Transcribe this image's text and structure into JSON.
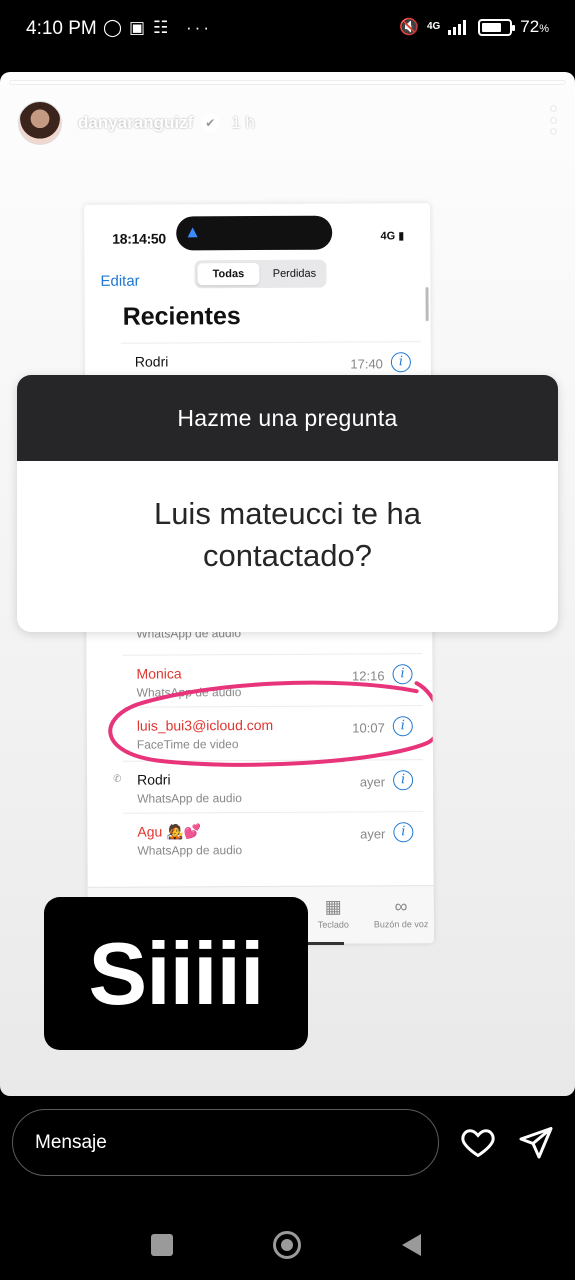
{
  "status_bar": {
    "time": "4:10 PM",
    "network": "4G",
    "battery_percent": "72",
    "battery_level": 0.72
  },
  "story": {
    "progress": 1.0,
    "username": "danyaranguizf",
    "time_ago": "1 h",
    "verified": true
  },
  "embedded_screenshot": {
    "time": "18:14:50",
    "signal": "4G",
    "edit_label": "Editar",
    "segment_all": "Todas",
    "segment_missed": "Perdidas",
    "title": "Recientes",
    "rows": [
      {
        "name": "Rodri",
        "subtitle": "",
        "time": "17:40",
        "missed": false
      },
      {
        "name": "",
        "subtitle": "WhatsApp de audio",
        "time": "",
        "missed": false
      },
      {
        "name": "Monica",
        "subtitle": "WhatsApp de audio",
        "time": "12:16",
        "missed": true
      },
      {
        "name": "luis_bui3@icloud.com",
        "subtitle": "FaceTime de video",
        "time": "10:07",
        "missed": true
      },
      {
        "name": "Rodri",
        "subtitle": "WhatsApp de audio",
        "time": "ayer",
        "missed": false
      },
      {
        "name": "Agu 🧑‍🎤💕",
        "subtitle": "WhatsApp de audio",
        "time": "ayer",
        "missed": true
      }
    ],
    "tabs": [
      "Teclado",
      "Buzón de voz"
    ],
    "accent": "#1f78d1",
    "missed_color": "#e0352f",
    "highlight_color": "#e8347a"
  },
  "question_sticker": {
    "header": "Hazme una pregunta",
    "question": "Luis mateucci te ha contactado?"
  },
  "answer_sticker": {
    "text": "Siiiii"
  },
  "bottom_bar": {
    "message_placeholder": "Mensaje"
  }
}
